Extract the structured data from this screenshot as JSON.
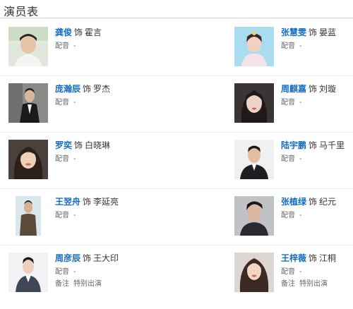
{
  "section_title": "演员表",
  "as_word": "饰",
  "dub_label": "配音",
  "dub_value": "-",
  "note_label": "备注",
  "rows": [
    {
      "left": {
        "actor": "龚俊",
        "role": "霍言",
        "photo": "actor-photo-gong-jun"
      },
      "right": {
        "actor": "张慧雯",
        "role": "晏蓝",
        "photo": "actor-photo-zhang-huiwen"
      }
    },
    {
      "left": {
        "actor": "庞瀚辰",
        "role": "罗杰",
        "photo": "actor-photo-pang-hanchen"
      },
      "right": {
        "actor": "周麒嘉",
        "role": "刘璇",
        "photo": "actor-photo-zhou-qijia"
      }
    },
    {
      "left": {
        "actor": "罗奕",
        "role": "白晓琳",
        "photo": "actor-photo-luo-yi"
      },
      "right": {
        "actor": "陆宇鹏",
        "role": "马千里",
        "photo": "actor-photo-lu-yupeng"
      }
    },
    {
      "left": {
        "actor": "王翌舟",
        "role": "李延亮",
        "photo": "actor-photo-wang-yizhou"
      },
      "right": {
        "actor": "张植绿",
        "role": "纪元",
        "photo": "actor-photo-zhang-zhilv"
      }
    },
    {
      "left": {
        "actor": "周彦辰",
        "role": "王大印",
        "photo": "actor-photo-zhou-yanchen",
        "note": "特别出演"
      },
      "right": {
        "actor": "王梓薇",
        "role": "江桐",
        "photo": "actor-photo-wang-ziwei",
        "note": "特别出演"
      }
    }
  ]
}
